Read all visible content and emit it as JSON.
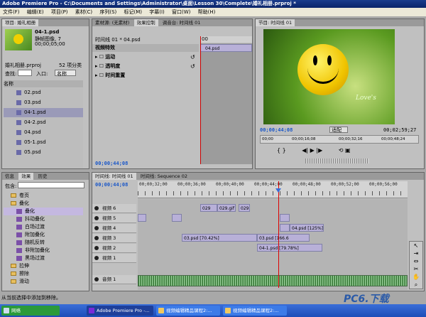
{
  "window": {
    "title": "Adobe Premiere Pro - C:\\Documents and Settings\\Administrator\\桌面\\Lesson 30\\Complete\\婚礼相册.prproj *"
  },
  "menu": [
    "文件(F)",
    "编辑(E)",
    "项目(P)",
    "素材(C)",
    "序列(S)",
    "标记(M)",
    "字幕(I)",
    "窗口(W)",
    "帮助(H)"
  ],
  "project": {
    "tab": "项目: 婚礼相册",
    "preview_name": "04-1.psd",
    "preview_type": "静帧图像, 7",
    "preview_duration": "00;00;05;00",
    "project_file": "婚礼相册.prproj",
    "item_count": "52 项分类",
    "find_label": "查找:",
    "entry_label": "入口:",
    "entry_value": "名称",
    "name_col": "名称",
    "items": [
      "02.psd",
      "03.psd",
      "04-1.psd",
      "04-2.psd",
      "04.psd",
      "05-1.psd",
      "05.psd"
    ]
  },
  "effect_controls": {
    "tabs": [
      "素材源: (无素材)",
      "效果控制",
      "调音台: 时间线 01"
    ],
    "sequence_label": "时间线 01 * 04.psd",
    "video_effects": "视频特效",
    "rows": [
      "运动",
      "透明度",
      "时间重置"
    ],
    "timecode": "00;00;44;08",
    "clip_name": "04.psd",
    "ruler_mark": "00"
  },
  "program": {
    "tab": "节目: 时间线 01",
    "watermark": "Love's",
    "current_time": "00;00;44;08",
    "fit_label": "适配",
    "duration": "00;02;59;27",
    "scrub_times": [
      "00;00",
      "00;00;16;08",
      "00;00;32;16",
      "00;00;48;24"
    ]
  },
  "effects": {
    "tabs": [
      "信息",
      "效果",
      "历史"
    ],
    "contains_label": "包含:",
    "tree": [
      {
        "label": "卷页",
        "kind": "folder",
        "level": 1
      },
      {
        "label": "叠化",
        "kind": "folder",
        "level": 1
      },
      {
        "label": "叠化",
        "kind": "fx",
        "level": 2
      },
      {
        "label": "抖动叠化",
        "kind": "fx",
        "level": 2
      },
      {
        "label": "白场过渡",
        "kind": "fx",
        "level": 2
      },
      {
        "label": "附加叠化",
        "kind": "fx",
        "level": 2
      },
      {
        "label": "随机反转",
        "kind": "fx",
        "level": 2
      },
      {
        "label": "非附加叠化",
        "kind": "fx",
        "level": 2
      },
      {
        "label": "黑场过渡",
        "kind": "fx",
        "level": 2
      },
      {
        "label": "拉伸",
        "kind": "folder",
        "level": 1
      },
      {
        "label": "擦除",
        "kind": "folder",
        "level": 1
      },
      {
        "label": "滑动",
        "kind": "folder",
        "level": 1
      }
    ]
  },
  "timeline": {
    "tabs": [
      "时间线: 时间线 01",
      "时间线: Sequence 02"
    ],
    "timecode": "00;00;44;08",
    "ruler": [
      "00;00;32;00",
      "00;00;36;00",
      "00;00;40;00",
      "00;00;44;00",
      "00;00;48;00",
      "00;00;52;00",
      "00;00;56;00"
    ],
    "tracks": [
      "视频 6",
      "视频 5",
      "视频 4",
      "视频 3",
      "视频 2",
      "视频 1",
      "音频 1"
    ],
    "clips": {
      "v6": [
        "029",
        "029.gif",
        "029"
      ],
      "v4": "04.psd [125%]",
      "v3a": "03.psd [70.42%]",
      "v3b": "03.psd [166.6",
      "v2": "04-1.psd [79.78%]"
    }
  },
  "status": "从当前选择中添加到移除。",
  "watermark_text": "PC6.下载",
  "taskbar": {
    "start": "网络",
    "items": [
      "Adobe Premiere Pro -...",
      "视频编辑精品课程2:...",
      "视频编辑精品课程2:..."
    ]
  }
}
